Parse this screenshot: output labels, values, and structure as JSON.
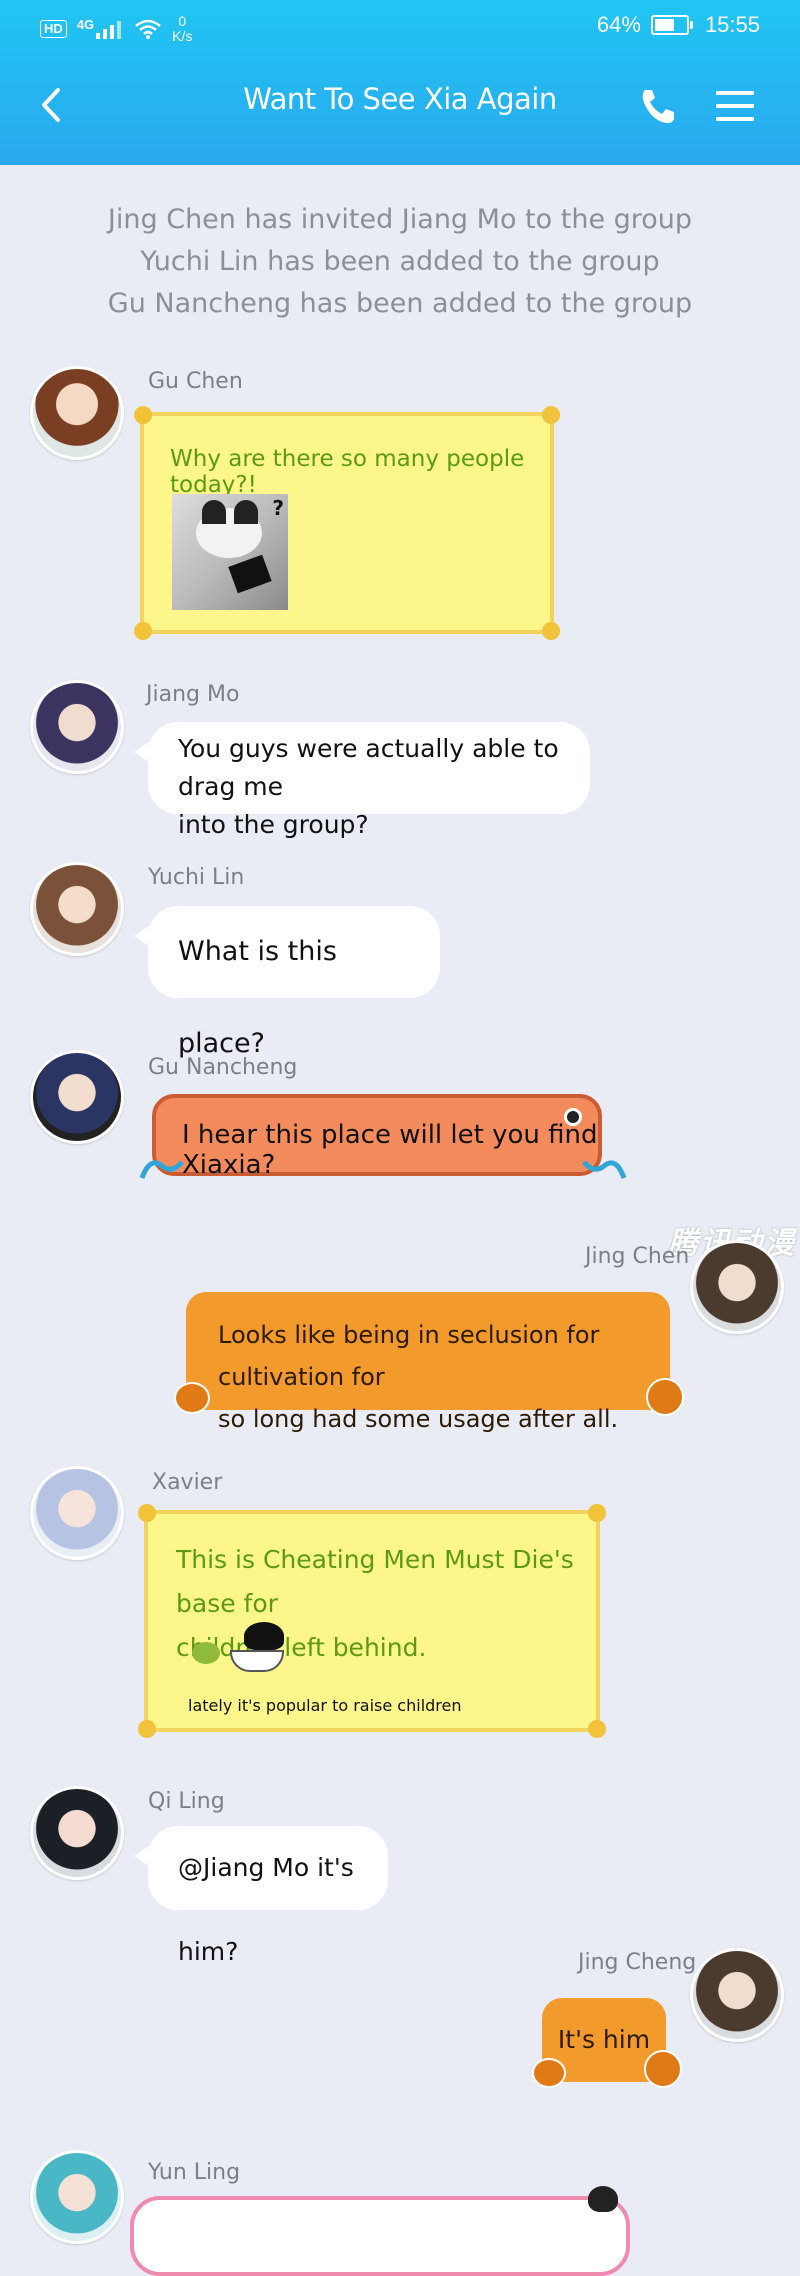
{
  "status_bar": {
    "network_badge": "HD",
    "network_type": "4G",
    "speed_value": "0",
    "speed_unit": "K/s",
    "battery_percent": "64%",
    "battery_level": 0.64,
    "time": "15:55"
  },
  "header": {
    "title": "Want To See Xia Again",
    "back_icon": "chevron-left-icon",
    "call_icon": "phone-icon",
    "menu_icon": "hamburger-menu-icon"
  },
  "system_messages": [
    "Jing Chen has invited Jiang Mo to the group",
    "Yuchi Lin has been added to the group",
    "Gu Nancheng has been added to the group"
  ],
  "messages": [
    {
      "sender": "Gu Chen",
      "text": "Why are there so many people today?!",
      "style": "yellow",
      "sticker": "confused-cat-sticker"
    },
    {
      "sender": "Jiang Mo",
      "lines": [
        "You guys were actually able to drag me",
        "into the group?"
      ],
      "style": "white"
    },
    {
      "sender": "Yuchi Lin",
      "text": "What is this place?",
      "style": "white"
    },
    {
      "sender": "Gu Nancheng",
      "text": "I hear this place will let you find Xiaxia?",
      "style": "salmon-fish"
    },
    {
      "sender": "Jing Chen",
      "lines": [
        "Looks like being in seclusion for cultivation for",
        "so long had some usage after all."
      ],
      "style": "orange",
      "side": "right"
    },
    {
      "sender": "Xavier",
      "lines": [
        "This is Cheating Men Must Die's base for",
        "children left behind."
      ],
      "style": "yellow",
      "sticker_caption": "lately it's popular to raise children"
    },
    {
      "sender": "Qi Ling",
      "text": "@Jiang Mo it's him?",
      "style": "white"
    },
    {
      "sender": "Jing Cheng",
      "text": "It's him",
      "style": "orange",
      "side": "right"
    },
    {
      "sender": "Yun Ling",
      "text": "",
      "style": "pink"
    }
  ],
  "watermark": "腾讯动漫",
  "colors": {
    "header": "#2aa8ee",
    "background": "#e9ecf4",
    "yellow_bubble": "#fdf68a",
    "yellow_text": "#5d9a12",
    "salmon_bubble": "#f48b5c",
    "orange_bubble": "#f29a2c"
  }
}
